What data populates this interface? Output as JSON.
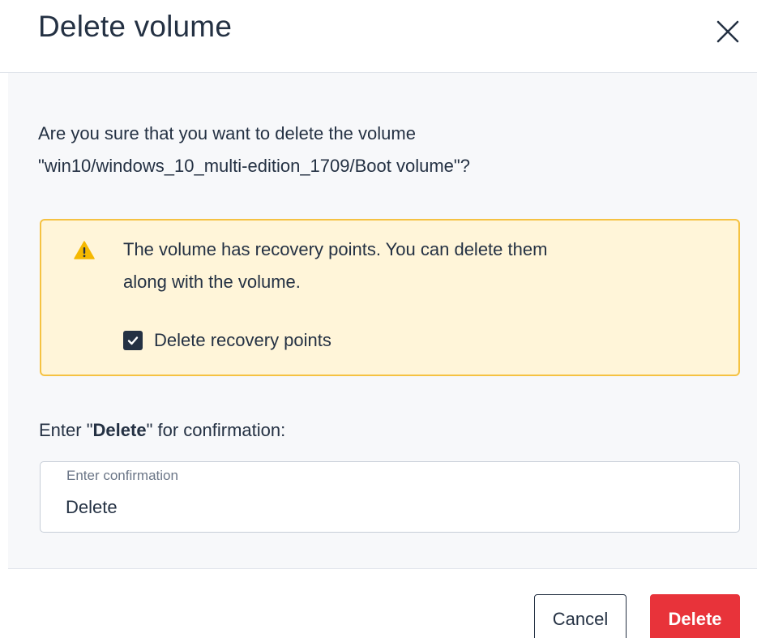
{
  "dialog": {
    "title": "Delete volume",
    "close_icon": "close-icon"
  },
  "body": {
    "question_line1": "Are you sure that you want to delete the volume",
    "question_line2": "\"win10/windows_10_multi-edition_1709/Boot volume\"?",
    "warning": {
      "icon": "warning-icon",
      "line1": "The volume has recovery points. You can delete them",
      "line2": "along with the volume.",
      "checkbox_label": "Delete recovery points",
      "checkbox_checked": true
    },
    "confirm": {
      "prefix": "Enter \"",
      "keyword": "Delete",
      "suffix": "\" for confirmation:"
    },
    "input": {
      "label": "Enter confirmation",
      "value": "Delete"
    }
  },
  "footer": {
    "cancel_label": "Cancel",
    "delete_label": "Delete"
  },
  "colors": {
    "text": "#243143",
    "body_bg": "#f7f8fa",
    "warning_bg": "#fff5d9",
    "warning_border": "#f5c242",
    "warning_icon": "#f5b800",
    "danger": "#e8333a"
  }
}
